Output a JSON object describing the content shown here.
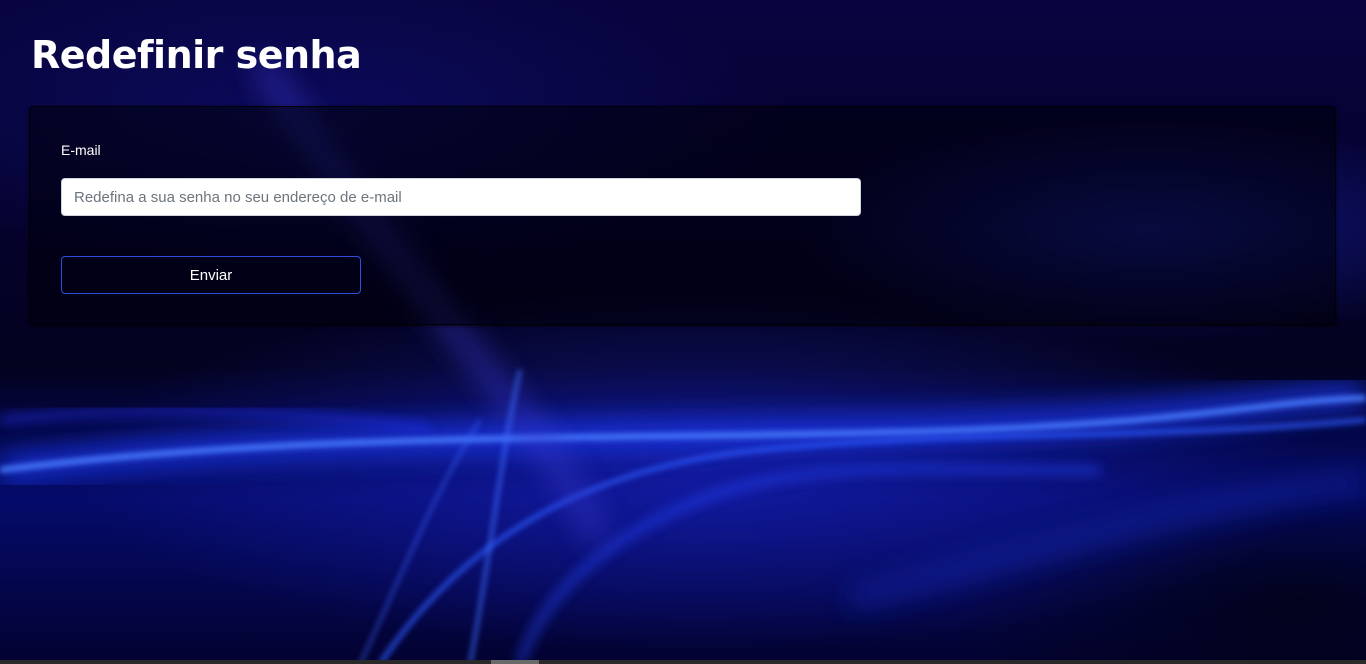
{
  "header": {
    "title": "Redefinir senha"
  },
  "form": {
    "email_label": "E-mail",
    "email_value": "",
    "email_placeholder": "Redefina a sua senha no seu endereço de e-mail",
    "submit_label": "Enviar"
  },
  "colors": {
    "background": "#03012a",
    "button_border": "#2d4de0",
    "text": "#ffffff"
  }
}
